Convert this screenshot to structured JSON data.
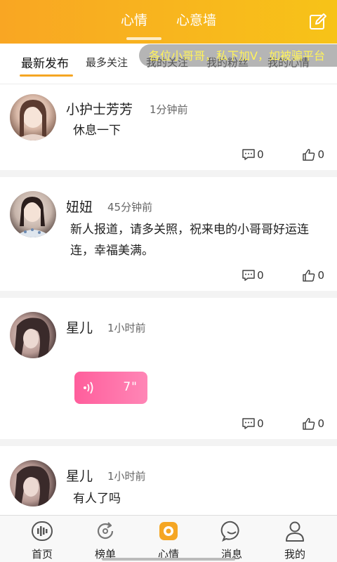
{
  "header": {
    "tabs": [
      {
        "label": "心情",
        "active": true
      },
      {
        "label": "心意墙",
        "active": false
      }
    ],
    "edit_icon": "edit-icon"
  },
  "subtabs": {
    "items": [
      "最新发布",
      "最多关注",
      "我的关注",
      "我的粉丝",
      "我的心情"
    ],
    "active": "最新发布"
  },
  "marquee": {
    "text": "各位小哥哥，私下加V，如被骗平台"
  },
  "posts": [
    {
      "name": "小护士芳芳",
      "time": "1分钟前",
      "content": "休息一下",
      "comments": "0",
      "likes": "0"
    },
    {
      "name": "妞妞",
      "time": "45分钟前",
      "content": "新人报道，请多关照，祝来电的小哥哥好运连连，幸福美满。",
      "comments": "0",
      "likes": "0"
    },
    {
      "name": "星儿",
      "time": "1小时前",
      "voice_duration": "7\"",
      "comments": "0",
      "likes": "0"
    },
    {
      "name": "星儿",
      "time": "1小时前",
      "content": "有人了吗"
    }
  ],
  "bottom_nav": [
    {
      "label": "首页",
      "icon": "voice-wave-icon"
    },
    {
      "label": "榜单",
      "icon": "refresh-icon"
    },
    {
      "label": "心情",
      "icon": "mood-icon",
      "active": true
    },
    {
      "label": "消息",
      "icon": "chat-bubble-icon"
    },
    {
      "label": "我的",
      "icon": "person-icon"
    }
  ],
  "colors": {
    "accent": "#f5a623",
    "voice_pink": "#ff6aa5",
    "marquee_text": "#fff35a"
  }
}
